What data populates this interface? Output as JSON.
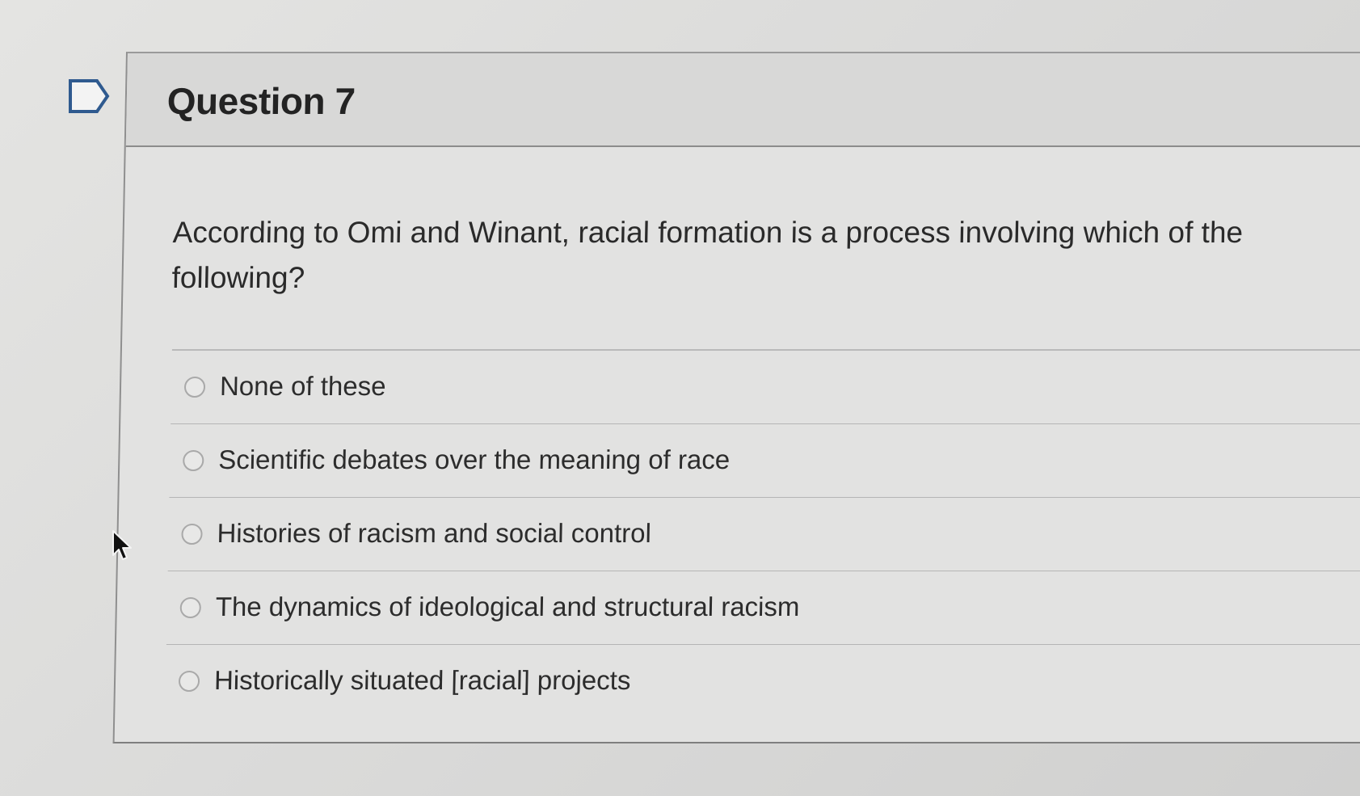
{
  "question": {
    "title": "Question 7",
    "prompt": "According to Omi and Winant, racial formation is a process involving which of the following?"
  },
  "options": [
    {
      "label": "None of these",
      "selected": false
    },
    {
      "label": "Scientific debates over the meaning of race",
      "selected": false
    },
    {
      "label": "Histories of racism and social control",
      "selected": false
    },
    {
      "label": "The dynamics of ideological and structural racism",
      "selected": false
    },
    {
      "label": "Historically situated [racial] projects",
      "selected": false
    }
  ],
  "icons": {
    "flag": "flag-outline-icon",
    "cursor": "mouse-pointer-icon"
  },
  "colors": {
    "background": "#dcdcdc",
    "text": "#2b2b2b",
    "divider": "#b5b5b5"
  }
}
